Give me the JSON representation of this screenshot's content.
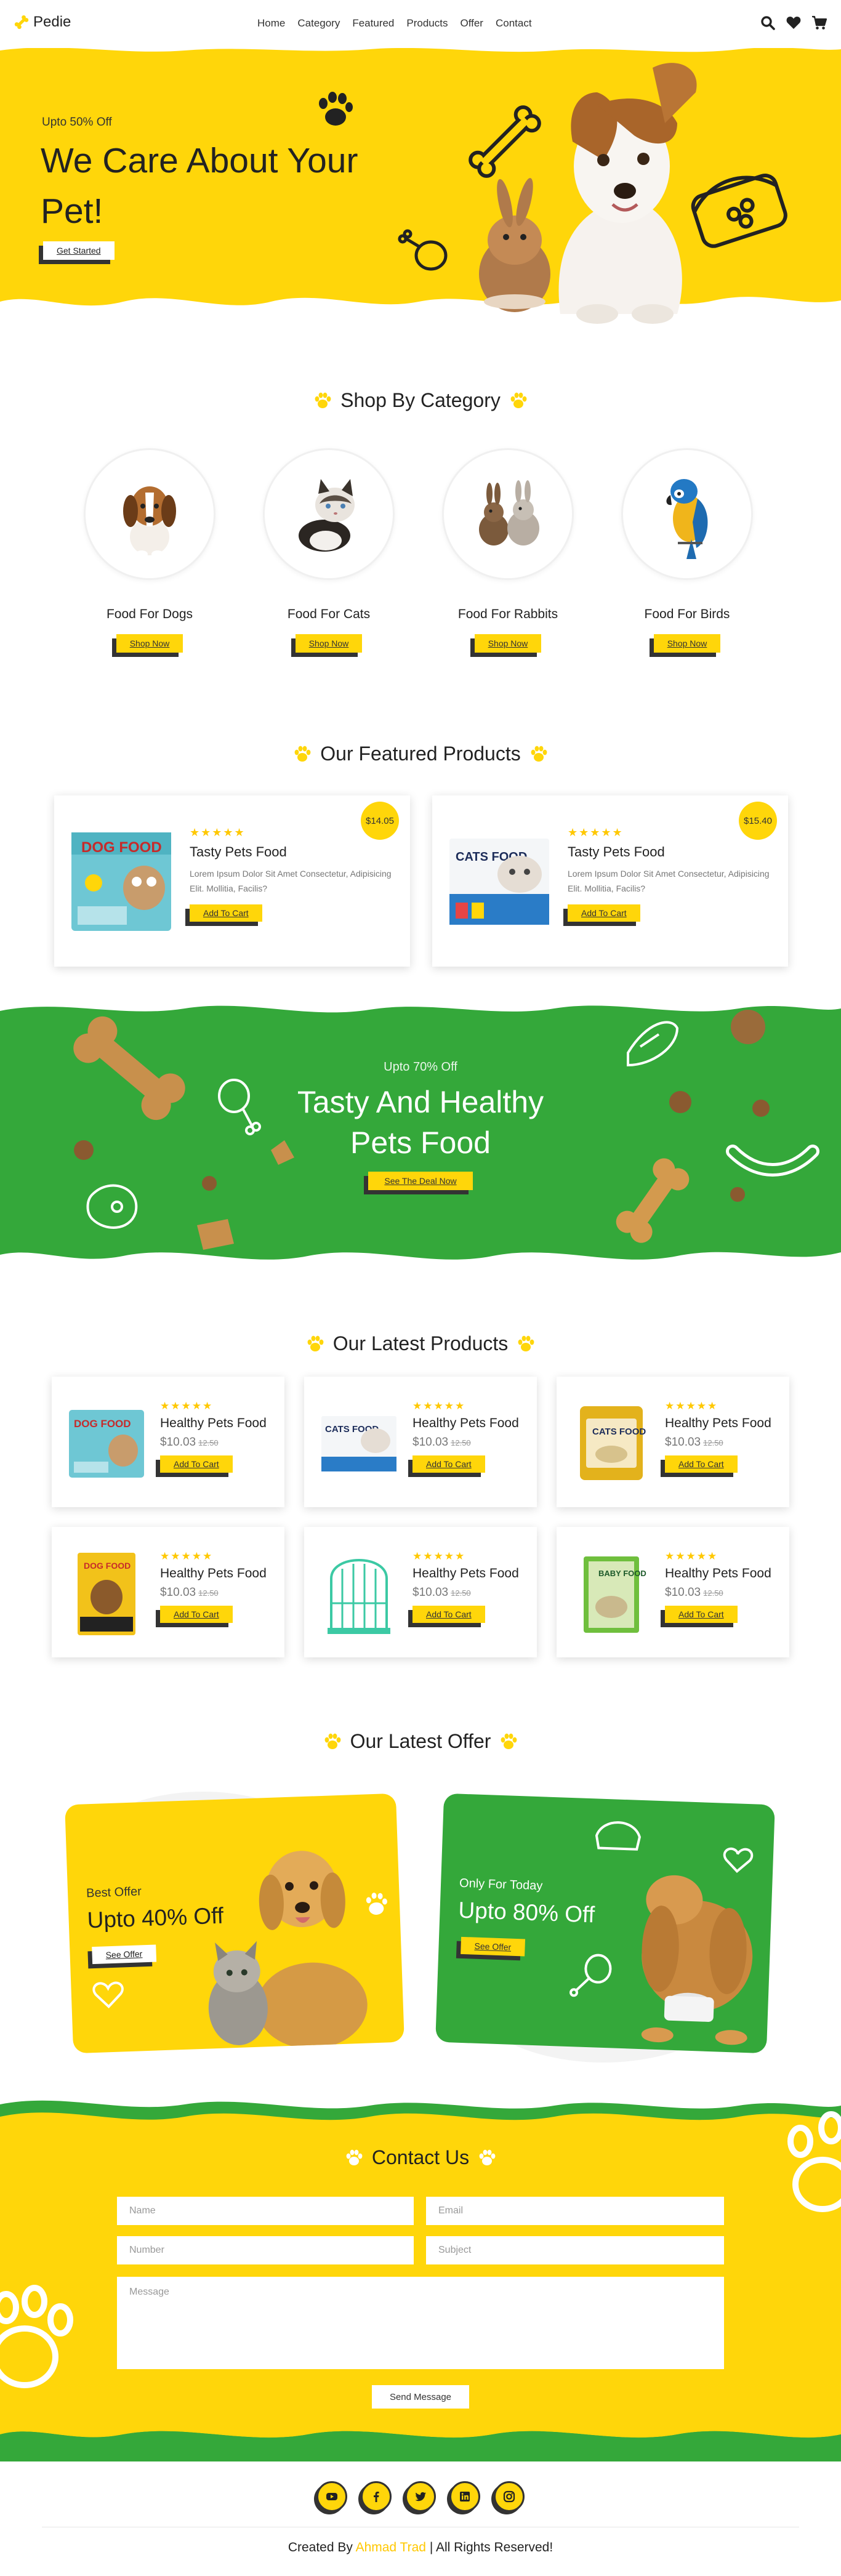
{
  "brand": {
    "name": "Pedie"
  },
  "nav": [
    "Home",
    "Category",
    "Featured",
    "Products",
    "Offer",
    "Contact"
  ],
  "header_icons": [
    "search-icon",
    "heart-icon",
    "cart-icon"
  ],
  "colors": {
    "yellow": "#ffd60a",
    "green": "#34a83a",
    "dark": "#333333"
  },
  "hero": {
    "subtitle": "Upto 50% Off",
    "title": "We Care About Your Pet!",
    "button": "Get Started"
  },
  "categories": {
    "title": "Shop By Category",
    "items": [
      {
        "name": "Food For Dogs",
        "button": "Shop Now"
      },
      {
        "name": "Food For Cats",
        "button": "Shop Now"
      },
      {
        "name": "Food For Rabbits",
        "button": "Shop Now"
      },
      {
        "name": "Food For Birds",
        "button": "Shop Now"
      }
    ]
  },
  "featured": {
    "title": "Our Featured Products",
    "items": [
      {
        "name": "Tasty Pets Food",
        "desc": "Lorem Ipsum Dolor Sit Amet Consectetur, Adipisicing Elit. Mollitia, Facilis?",
        "price": "$14.05",
        "button": "Add To Cart",
        "stars": "★★★★★",
        "package_label": "DOG FOOD"
      },
      {
        "name": "Tasty Pets Food",
        "desc": "Lorem Ipsum Dolor Sit Amet Consectetur, Adipisicing Elit. Mollitia, Facilis?",
        "price": "$15.40",
        "button": "Add To Cart",
        "stars": "★★★★★",
        "package_label": "CATS FOOD"
      }
    ]
  },
  "promo": {
    "subtitle": "Upto 70% Off",
    "title_line1": "Tasty And Healthy",
    "title_line2": "Pets Food",
    "button": "See The Deal Now"
  },
  "latest": {
    "title": "Our Latest Products",
    "items": [
      {
        "name": "Healthy Pets Food",
        "price": "$10.03",
        "old_price": "12.50",
        "button": "Add To Cart",
        "stars": "★★★★★",
        "package_label": "DOG FOOD"
      },
      {
        "name": "Healthy Pets Food",
        "price": "$10.03",
        "old_price": "12.50",
        "button": "Add To Cart",
        "stars": "★★★★★",
        "package_label": "CATS FOOD"
      },
      {
        "name": "Healthy Pets Food",
        "price": "$10.03",
        "old_price": "12.50",
        "button": "Add To Cart",
        "stars": "★★★★★",
        "package_label": "CATS FOOD"
      },
      {
        "name": "Healthy Pets Food",
        "price": "$10.03",
        "old_price": "12.50",
        "button": "Add To Cart",
        "stars": "★★★★★",
        "package_label": "DOG FOOD"
      },
      {
        "name": "Healthy Pets Food",
        "price": "$10.03",
        "old_price": "12.50",
        "button": "Add To Cart",
        "stars": "★★★★★"
      },
      {
        "name": "Healthy Pets Food",
        "price": "$10.03",
        "old_price": "12.50",
        "button": "Add To Cart",
        "stars": "★★★★★",
        "package_label": "BABY FOOD"
      }
    ]
  },
  "offers": {
    "title": "Our Latest Offer",
    "items": [
      {
        "subtitle": "Best Offer",
        "title": "Upto 40% Off",
        "button": "See Offer"
      },
      {
        "subtitle": "Only For Today",
        "title": "Upto 80% Off",
        "button": "See Offer"
      }
    ]
  },
  "contact": {
    "title": "Contact Us",
    "fields": {
      "name": "Name",
      "email": "Email",
      "number": "Number",
      "subject": "Subject",
      "message": "Message"
    },
    "button": "Send Message"
  },
  "footer": {
    "socials": [
      "youtube-icon",
      "facebook-icon",
      "twitter-icon",
      "linkedin-icon",
      "instagram-icon"
    ],
    "credit_prefix": "Created By",
    "credit_author": "Ahmad Trad",
    "credit_suffix": "| All Rights Reserved!"
  }
}
